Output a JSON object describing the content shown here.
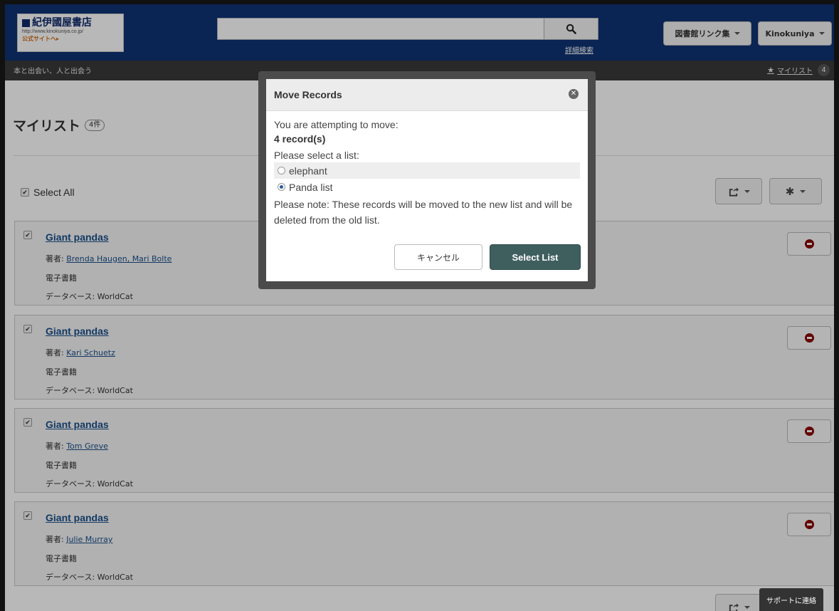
{
  "header": {
    "logo": {
      "title": "紀伊國屋書店",
      "url": "http://www.kinokuniya.co.jp/",
      "link": "公式サイトへ▸"
    },
    "search": {
      "value": "",
      "placeholder": ""
    },
    "advanced_search": "詳細検索",
    "library_links_label": "図書館リンク集",
    "account_label": "Kinokuniya"
  },
  "subbar": {
    "tagline": "本と出会い、人と出会う",
    "mylist_label": "マイリスト",
    "mylist_count": "4"
  },
  "page": {
    "title": "マイリスト",
    "count": "4件",
    "select_all_label": "Select All"
  },
  "records": [
    {
      "title": "Giant pandas",
      "author_label": "著者: ",
      "authors": "Brenda Haugen, Mari Bolte",
      "format": "電子書籍",
      "database_label": "データベース: ",
      "database": "WorldCat",
      "checked": true
    },
    {
      "title": "Giant pandas",
      "author_label": "著者: ",
      "authors": "Kari Schuetz",
      "format": "電子書籍",
      "database_label": "データベース: ",
      "database": "WorldCat",
      "checked": true
    },
    {
      "title": "Giant pandas",
      "author_label": "著者: ",
      "authors": "Tom Greve",
      "format": "電子書籍",
      "database_label": "データベース: ",
      "database": "WorldCat",
      "checked": true
    },
    {
      "title": "Giant pandas",
      "author_label": "著者: ",
      "authors": "Julie Murray",
      "format": "電子書籍",
      "database_label": "データベース: ",
      "database": "WorldCat",
      "checked": true
    }
  ],
  "support_label": "サポートに連絡",
  "modal": {
    "title": "Move Records",
    "intro": "You are attempting to move:",
    "count_text": "4 record(s)",
    "select_prompt": "Please select a list:",
    "options": [
      {
        "label": "elephant",
        "selected": false
      },
      {
        "label": "Panda list",
        "selected": true
      }
    ],
    "note": "Please note: These records will be moved to the new list and will be deleted from the old list.",
    "cancel_label": "キャンセル",
    "select_label": "Select List"
  },
  "icons": {
    "search": "search-icon",
    "star": "star-icon",
    "share": "share-icon",
    "gear": "gear-icon",
    "delete": "delete-icon",
    "close": "close-icon"
  }
}
